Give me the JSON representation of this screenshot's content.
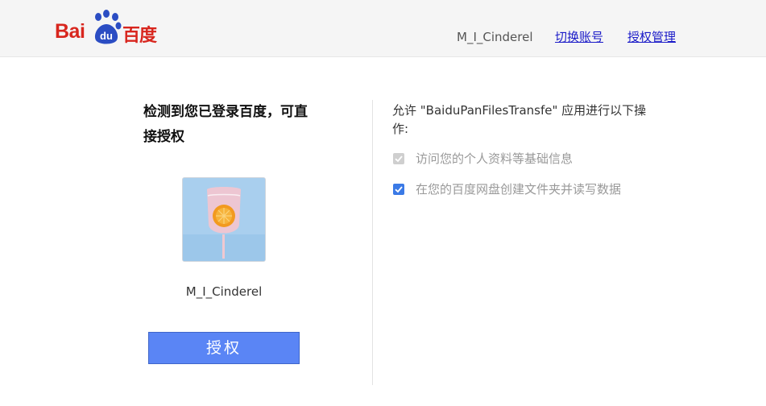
{
  "header": {
    "logo": {
      "latin": "Bai",
      "paw_text": "du",
      "chinese": "百度",
      "color": "#d8261e"
    },
    "username": "M_I_Cinderel",
    "switch_account_label": "切换账号",
    "auth_manage_label": "授权管理"
  },
  "left_panel": {
    "title": "检测到您已登录百度，可直接授权",
    "avatar_icon": "user-avatar-orange-drink",
    "username": "M_I_Cinderel",
    "authorize_button_label": "授权",
    "button_color": "#5a85f5"
  },
  "right_panel": {
    "description": "允许 \"BaiduPanFilesTransfe\" 应用进行以下操作:",
    "permissions": [
      {
        "label": "访问您的个人资料等基础信息",
        "checked": true,
        "disabled": true
      },
      {
        "label": "在您的百度网盘创建文件夹并读写数据",
        "checked": true,
        "disabled": false
      }
    ],
    "accent_color": "#3b7ae6"
  }
}
